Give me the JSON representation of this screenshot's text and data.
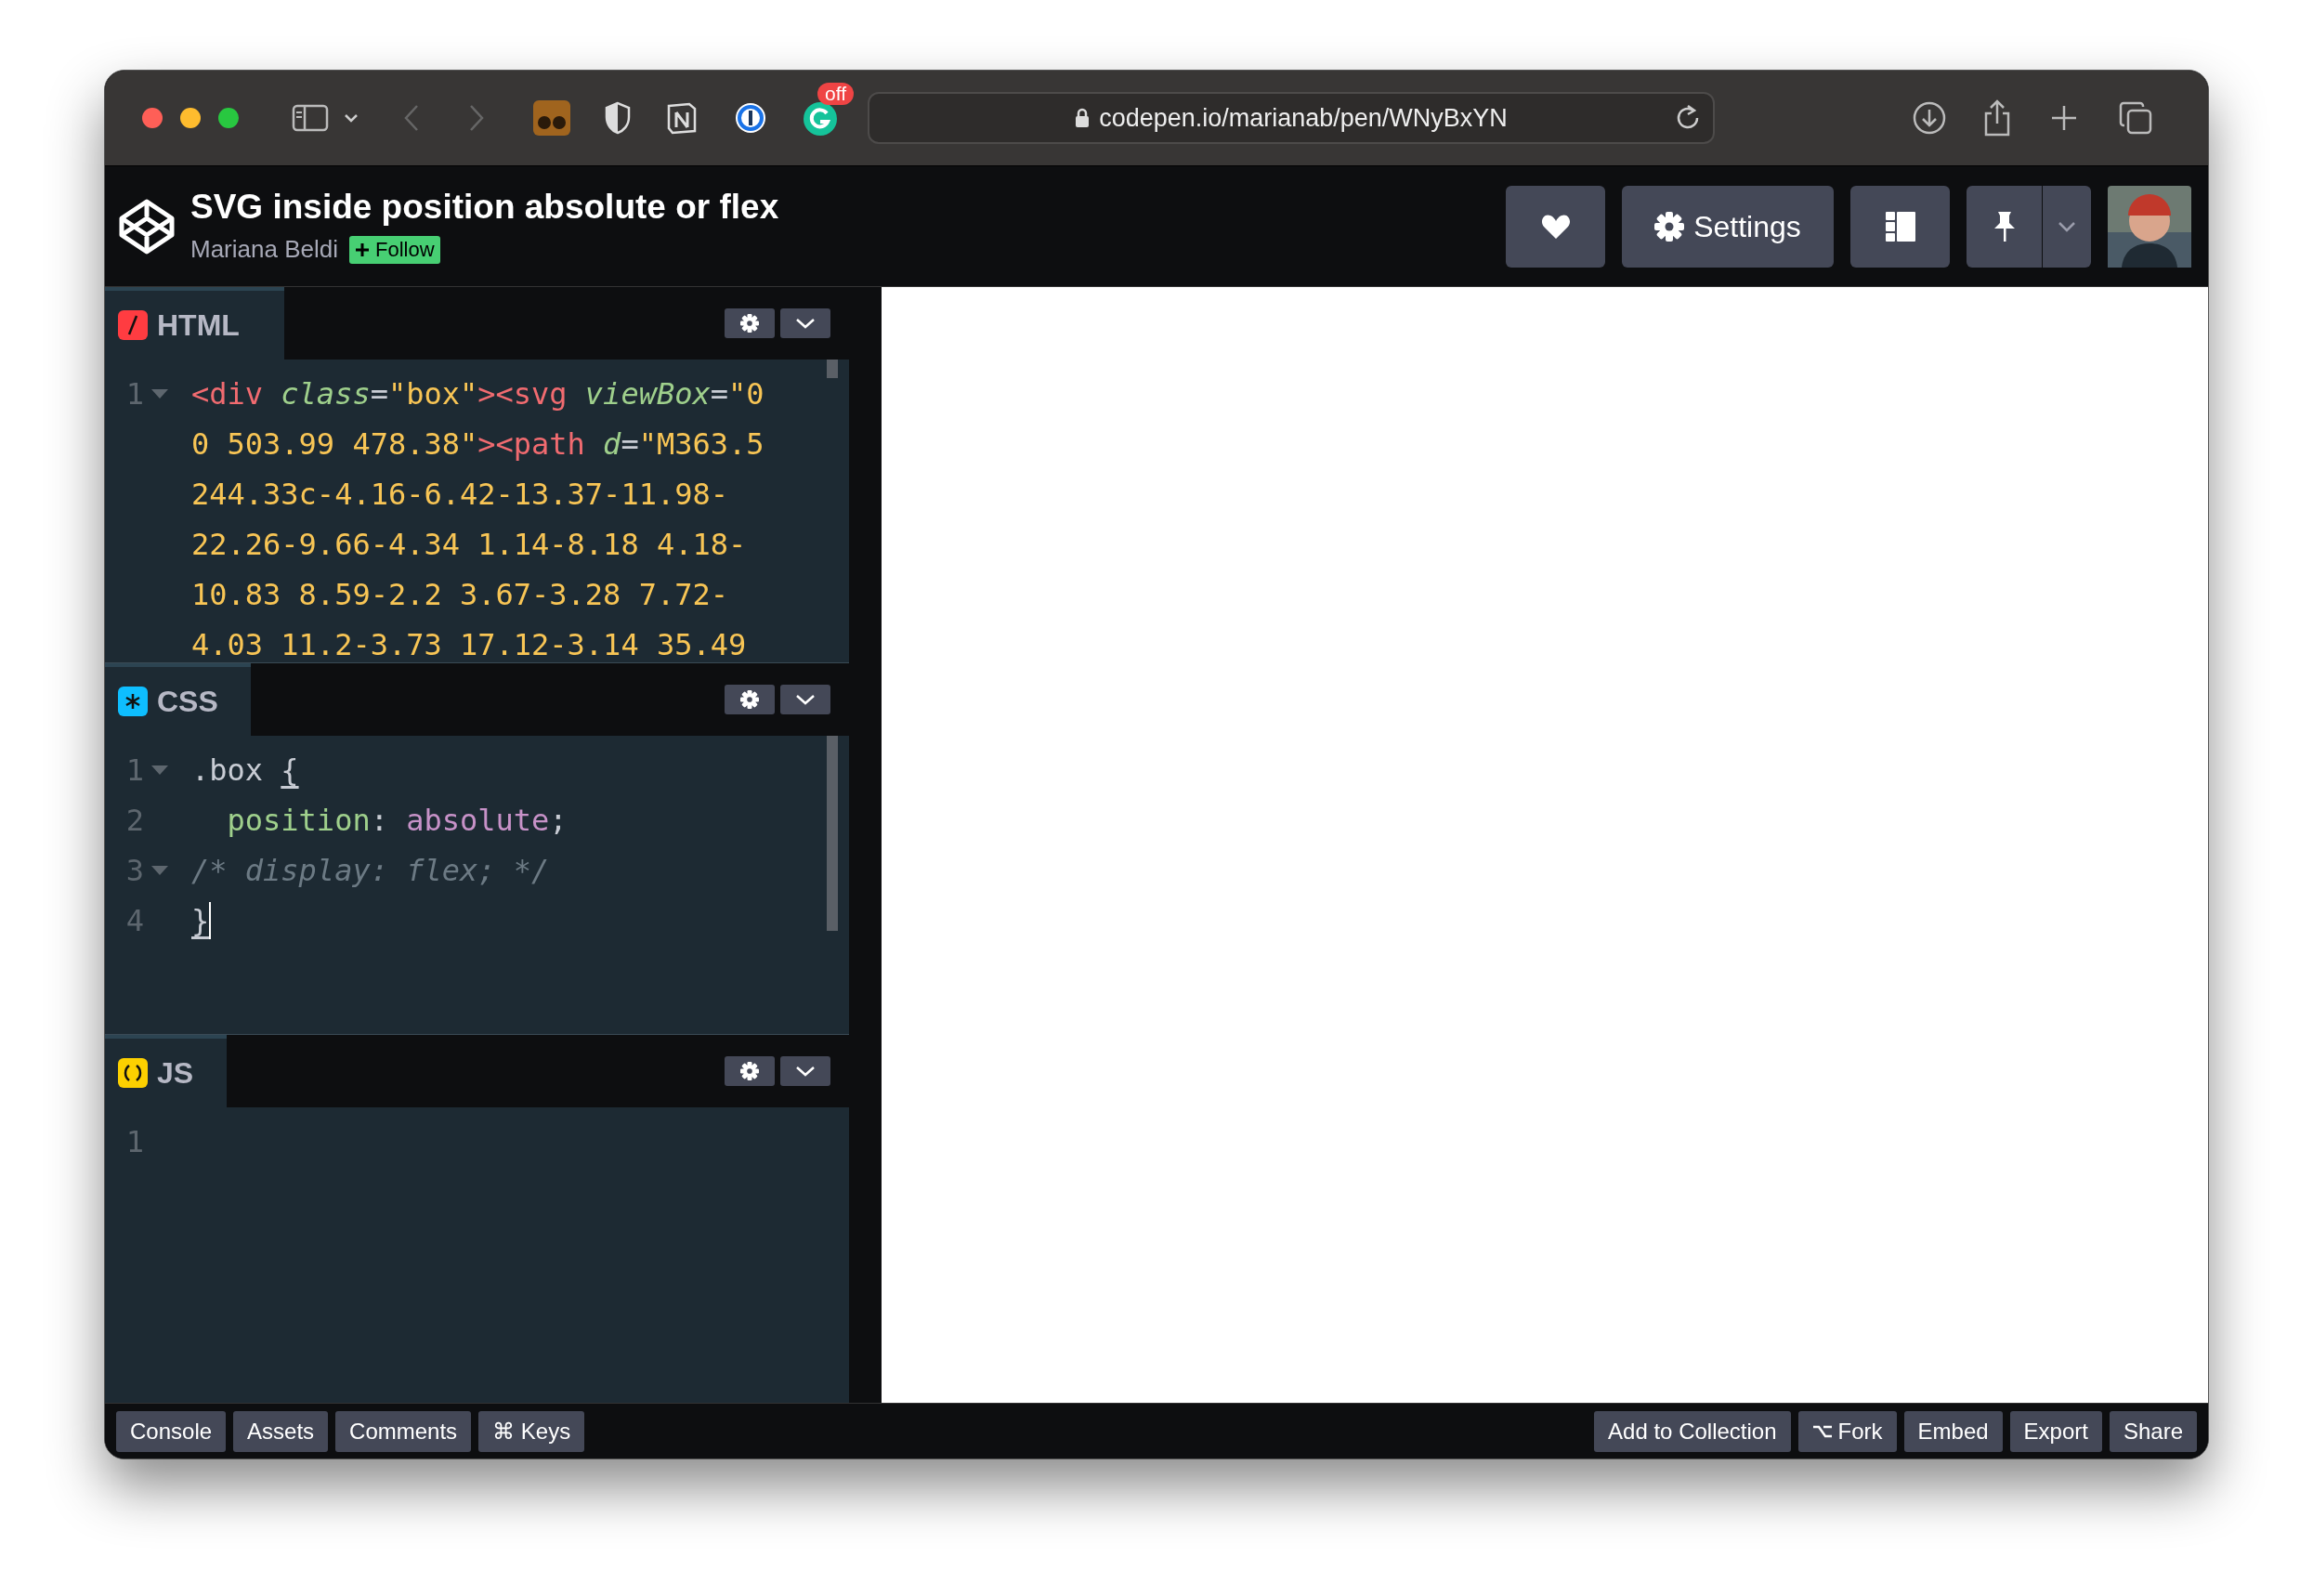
{
  "browser": {
    "url": "codepen.io/marianab/pen/WNyBxYN",
    "extension_badge": "off"
  },
  "pen": {
    "title": "SVG inside position absolute or flex",
    "author": "Mariana Beldi",
    "follow": "Follow"
  },
  "header_buttons": {
    "settings": "Settings"
  },
  "editors": [
    {
      "kind": "html",
      "label": "HTML",
      "rows": [
        {
          "number": "1",
          "fold": true,
          "tokens": [
            {
              "kind": "tag",
              "text": "<div "
            },
            {
              "kind": "attr",
              "text": "class"
            },
            {
              "kind": "punct",
              "text": "="
            },
            {
              "kind": "string",
              "text": "\"box\""
            },
            {
              "kind": "tag",
              "text": "><svg "
            },
            {
              "kind": "attr",
              "text": "viewBox"
            },
            {
              "kind": "punct",
              "text": "="
            },
            {
              "kind": "string",
              "text": "\"0"
            }
          ]
        },
        {
          "tokens": [
            {
              "kind": "string",
              "text": "0 503.99 478.38\""
            },
            {
              "kind": "tag",
              "text": "><path "
            },
            {
              "kind": "attr",
              "text": "d"
            },
            {
              "kind": "punct",
              "text": "="
            },
            {
              "kind": "string",
              "text": "\"M363.5"
            }
          ]
        },
        {
          "tokens": [
            {
              "kind": "string",
              "text": "244.33c-4.16-6.42-13.37-11.98-"
            }
          ]
        },
        {
          "tokens": [
            {
              "kind": "string",
              "text": "22.26-9.66-4.34 1.14-8.18 4.18-"
            }
          ]
        },
        {
          "tokens": [
            {
              "kind": "string",
              "text": "10.83 8.59-2.2 3.67-3.28 7.72-"
            }
          ]
        },
        {
          "tokens": [
            {
              "kind": "string",
              "text": "4.03 11.2-3.73 17.12-3.14 35.49"
            }
          ]
        }
      ]
    },
    {
      "kind": "css",
      "label": "CSS",
      "rows": [
        {
          "number": "1",
          "fold": true,
          "tokens": [
            {
              "kind": "plain",
              "text": ".box "
            },
            {
              "kind": "bracket",
              "text": "{",
              "matched": true
            }
          ]
        },
        {
          "number": "2",
          "fold": false,
          "tokens": [
            {
              "kind": "property",
              "text": "  position"
            },
            {
              "kind": "punct",
              "text": ": "
            },
            {
              "kind": "value",
              "text": "absolute"
            },
            {
              "kind": "punct",
              "text": ";"
            }
          ]
        },
        {
          "number": "3",
          "fold": true,
          "tokens": [
            {
              "kind": "comment",
              "text": "/* display: flex; */"
            }
          ]
        },
        {
          "number": "4",
          "fold": false,
          "tokens": [
            {
              "kind": "bracket",
              "text": "}",
              "matched": true,
              "cursor": true
            }
          ]
        }
      ]
    },
    {
      "kind": "js",
      "label": "JS",
      "rows": [
        {
          "number": "1",
          "fold": false,
          "tokens": []
        }
      ]
    }
  ],
  "footer": {
    "left": [
      "Console",
      "Assets",
      "Comments",
      "⌘ Keys"
    ],
    "right": [
      {
        "kind": "text",
        "label": "Add to Collection"
      },
      {
        "kind": "fork",
        "label": "Fork"
      },
      {
        "kind": "text",
        "label": "Embed"
      },
      {
        "kind": "text",
        "label": "Export"
      },
      {
        "kind": "text",
        "label": "Share"
      }
    ]
  }
}
